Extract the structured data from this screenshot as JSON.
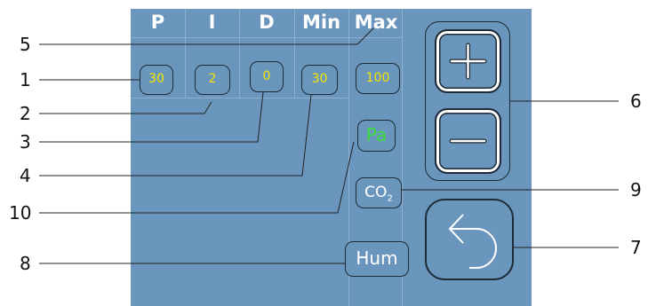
{
  "headers": {
    "p": "P",
    "i": "I",
    "d": "D",
    "min": "Min",
    "max": "Max"
  },
  "values": {
    "p": "30",
    "i": "2",
    "d": "0",
    "min": "30",
    "max": "100"
  },
  "modes": {
    "pa": "Pa",
    "co2": "CO",
    "co2_sub": "2",
    "hum": "Hum"
  },
  "callouts": {
    "c1": "1",
    "c2": "2",
    "c3": "3",
    "c4": "4",
    "c5": "5",
    "c6": "6",
    "c7": "7",
    "c8": "8",
    "c9": "9",
    "c10": "10"
  },
  "colors": {
    "panel": "#6a96bd",
    "value_text": "#f2e600",
    "active_mode": "#3ddc3d",
    "text": "#ffffff"
  }
}
